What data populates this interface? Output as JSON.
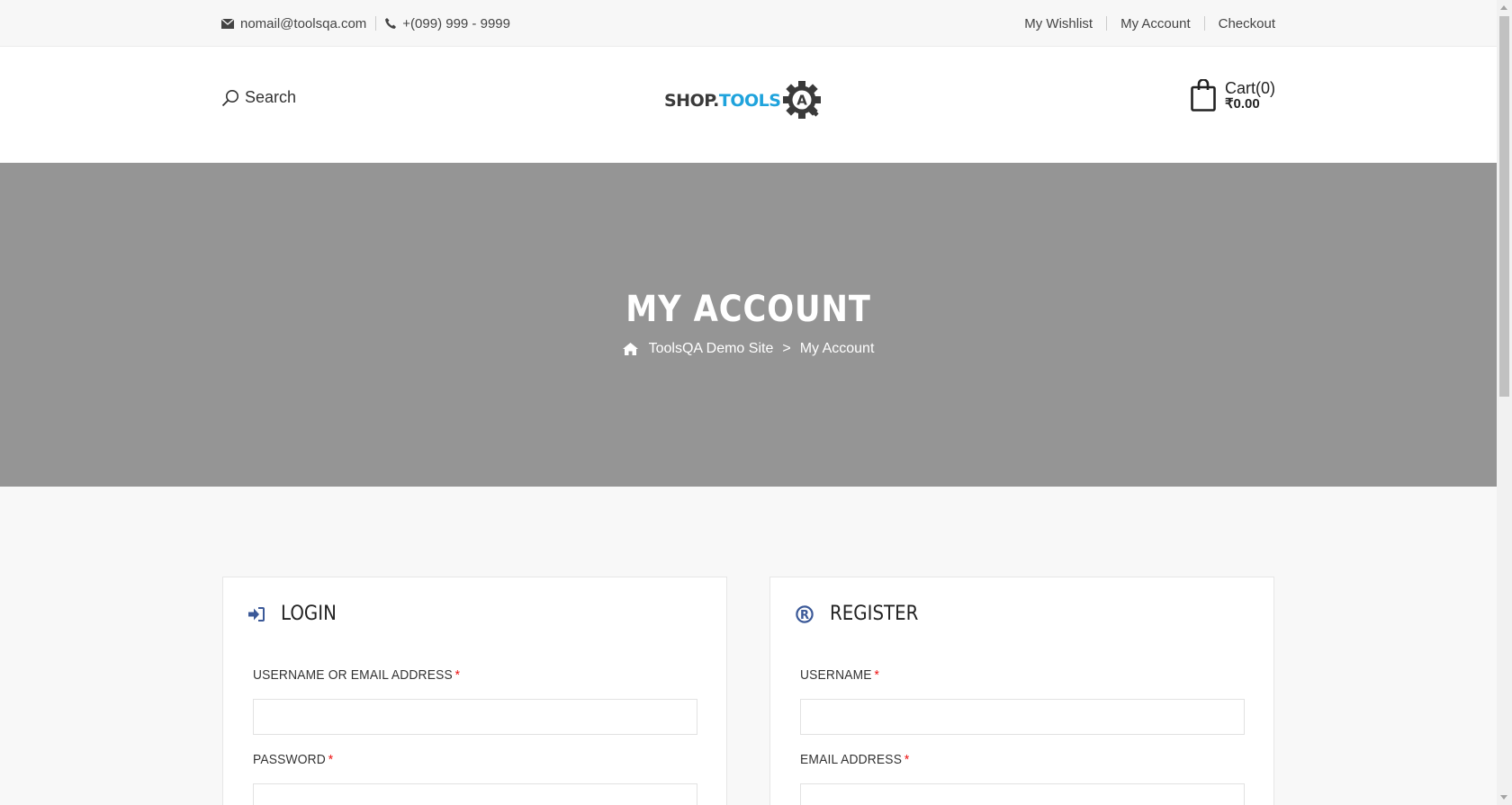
{
  "topbar": {
    "email": "nomail@toolsqa.com",
    "phone": "+(099) 999 - 9999",
    "links": [
      "My Wishlist",
      "My Account",
      "Checkout"
    ]
  },
  "header": {
    "search_label": "Search",
    "logo": {
      "part1": "SHOP.",
      "part2": "TOOLS",
      "mark": "A"
    },
    "cart_label": "Cart(0)",
    "cart_total": "₹0.00"
  },
  "hero": {
    "title": "MY ACCOUNT",
    "breadcrumb": {
      "home": "ToolsQA Demo Site",
      "separator": ">",
      "current": "My Account"
    }
  },
  "login": {
    "title": "LOGIN",
    "username_label": "USERNAME OR EMAIL ADDRESS",
    "password_label": "PASSWORD",
    "required_mark": "*"
  },
  "register": {
    "title": "REGISTER",
    "username_label": "USERNAME",
    "email_label": "EMAIL ADDRESS",
    "required_mark": "*"
  },
  "colors": {
    "accent": "#1fa3dc",
    "hero_bg": "#959595",
    "icon_blue": "#3b5998",
    "required": "#e11111"
  },
  "icons": [
    "envelope-icon",
    "phone-icon",
    "search-icon",
    "cart-bag-icon",
    "home-icon",
    "sign-in-icon",
    "registered-icon"
  ]
}
